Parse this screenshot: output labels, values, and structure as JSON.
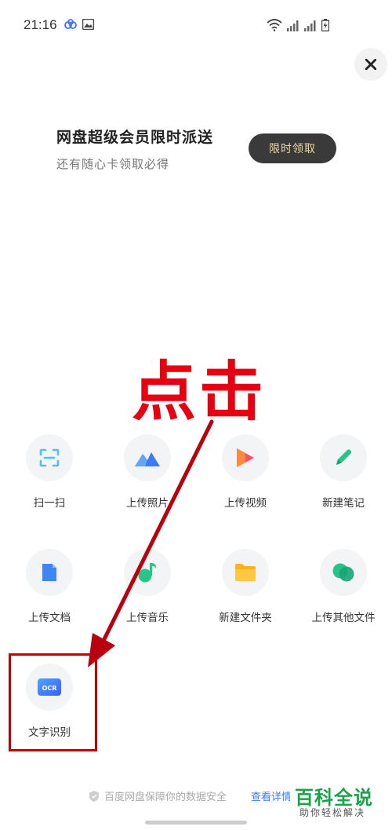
{
  "status_bar": {
    "time": "21:16"
  },
  "promo": {
    "title": "网盘超级会员限时派送",
    "subtitle": "还有随心卡领取必得",
    "button": "限时领取"
  },
  "annotation": {
    "text": "点击"
  },
  "grid": {
    "items": [
      {
        "label": "扫一扫",
        "icon": "scan-icon"
      },
      {
        "label": "上传照片",
        "icon": "photo-icon"
      },
      {
        "label": "上传视频",
        "icon": "video-icon"
      },
      {
        "label": "新建笔记",
        "icon": "note-icon"
      },
      {
        "label": "上传文档",
        "icon": "document-icon"
      },
      {
        "label": "上传音乐",
        "icon": "music-icon"
      },
      {
        "label": "新建文件夹",
        "icon": "folder-icon"
      },
      {
        "label": "上传其他文件",
        "icon": "other-file-icon"
      },
      {
        "label": "文字识别",
        "icon": "ocr-icon",
        "badge": "OCR"
      }
    ]
  },
  "footer": {
    "security_text": "百度网盘保障你的数据安全",
    "link": "查看详情"
  },
  "watermark": {
    "main": "百科全说",
    "sub": "助你轻松解决"
  },
  "colors": {
    "annotation": "#e60012",
    "link": "#3c78ff",
    "watermark": "#1aa34a"
  }
}
